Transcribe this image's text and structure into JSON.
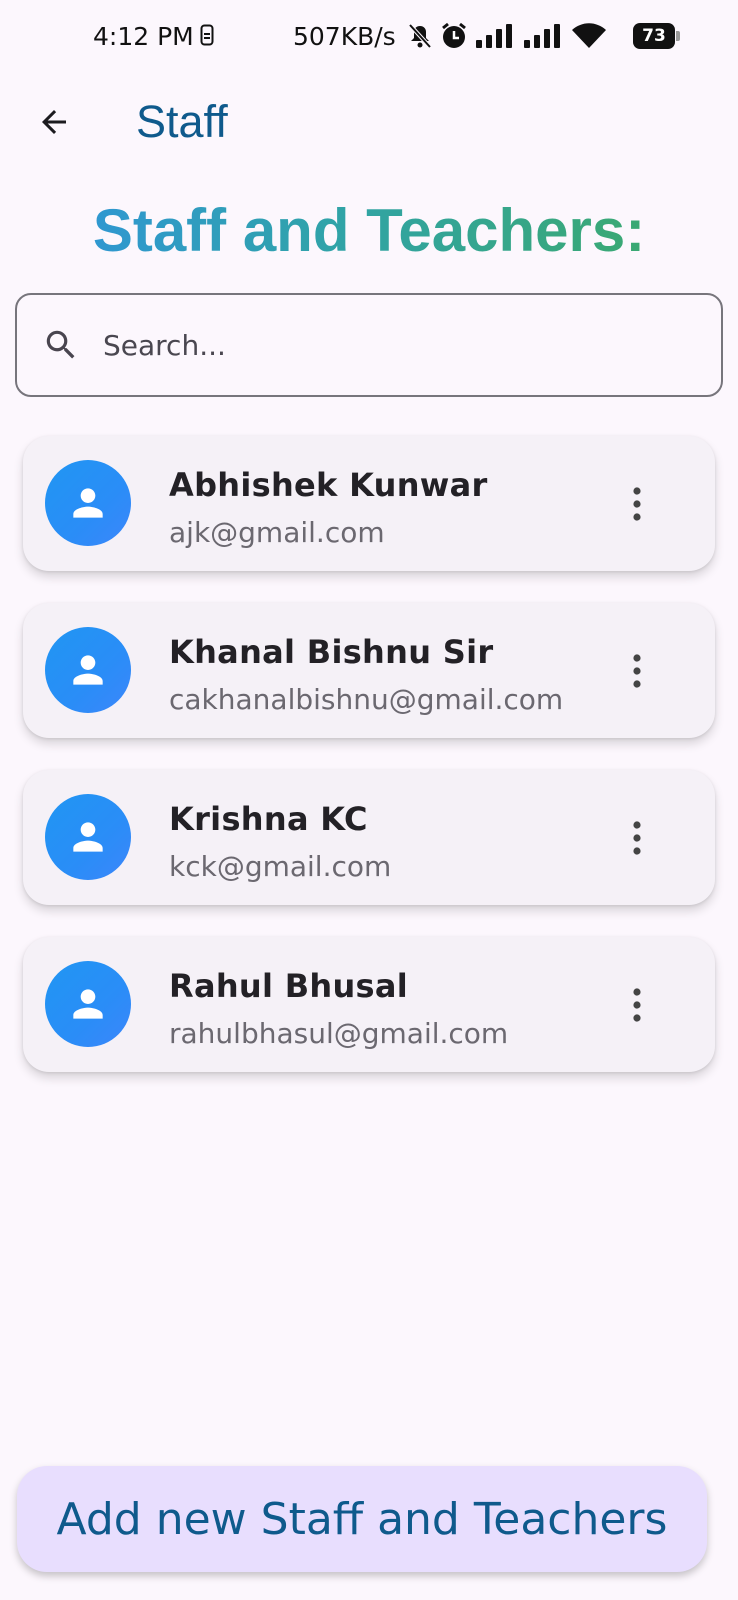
{
  "status_bar": {
    "time": "4:12 PM",
    "net_speed": "507KB/s",
    "battery": "73",
    "icons": [
      "sim-icon",
      "mute-bell-icon",
      "alarm-icon",
      "signal-icon",
      "signal-icon",
      "wifi-icon",
      "battery-icon"
    ]
  },
  "app_bar": {
    "title": "Staff",
    "back_icon": "arrow-back-icon"
  },
  "headline": "Staff and Teachers:",
  "search": {
    "placeholder": "Search...",
    "value": ""
  },
  "staff": [
    {
      "name": "Abhishek Kunwar",
      "email": "ajk@gmail.com"
    },
    {
      "name": "Khanal Bishnu Sir",
      "email": "cakhanalbishnu@gmail.com"
    },
    {
      "name": "Krishna KC",
      "email": "kck@gmail.com"
    },
    {
      "name": "Rahul Bhusal",
      "email": "rahulbhasul@gmail.com"
    }
  ],
  "add_button_label": "Add new Staff and Teachers",
  "colors": {
    "primary": "#0f5a8c",
    "avatar": "#2096f3",
    "background": "#fcf7fd",
    "card": "#f5f1f7",
    "button_bg": "#e8defe"
  }
}
